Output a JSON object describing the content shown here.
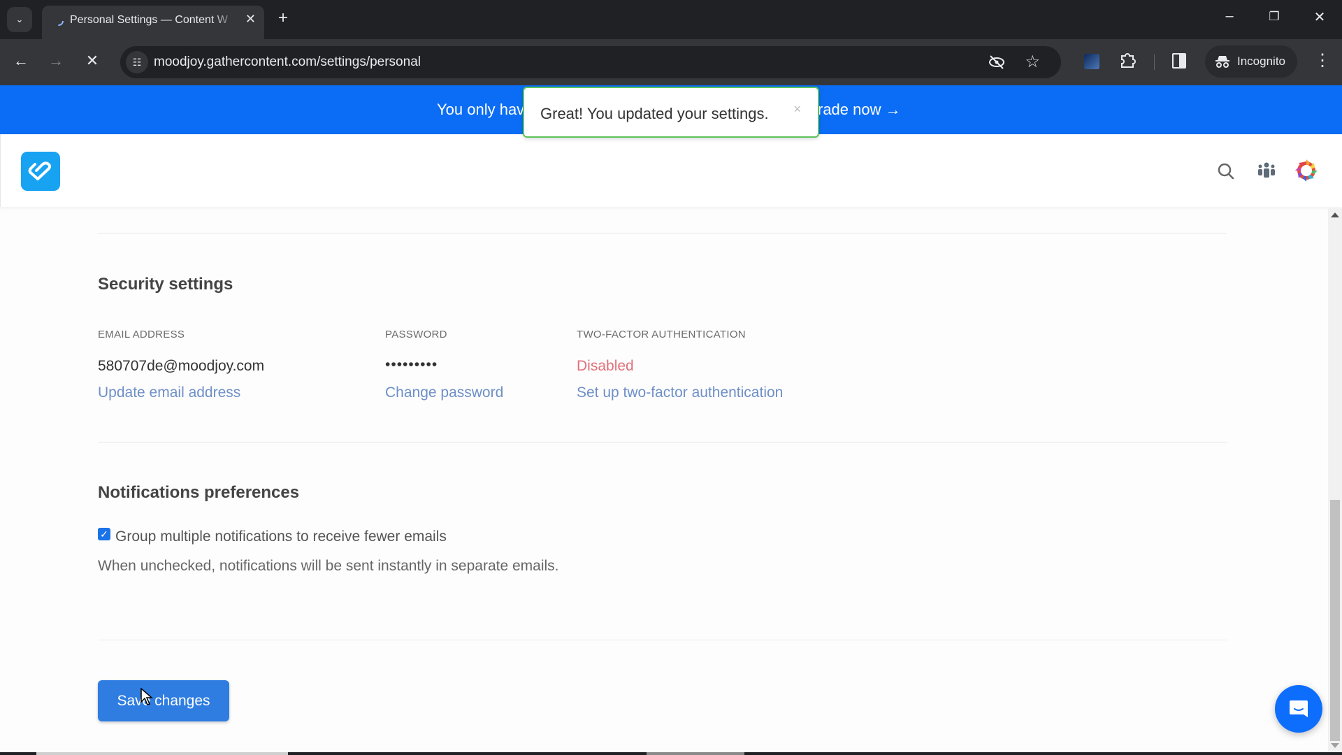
{
  "browser": {
    "tab_title": "Personal Settings — Content W",
    "url": "moodjoy.gathercontent.com/settings/personal",
    "profile_label": "Incognito",
    "icons": {
      "tab_list": "chevron-down-icon",
      "tab_close": "close-icon",
      "new_tab": "plus-icon",
      "back": "arrow-left-icon",
      "forward": "arrow-right-icon",
      "stop": "close-icon",
      "site_info": "tune-icon",
      "tracking": "eye-off-icon",
      "bookmark": "star-icon",
      "extensions": "puzzle-icon",
      "side_panel": "side-panel-icon",
      "incognito": "incognito-icon",
      "menu": "more-vert-icon"
    },
    "window_controls": {
      "minimize": "–",
      "restore": "❐",
      "close": "✕"
    }
  },
  "banner": {
    "text_left": "You only hav",
    "text_right": "rade now →",
    "color": "#0b6df5"
  },
  "toast": {
    "message": "Great! You updated your settings.",
    "close_label": "×",
    "border_color": "#5cc25a"
  },
  "header": {
    "logo": "gathercontent-logo",
    "icons": [
      "search-icon",
      "team-icon",
      "workspace-avatar"
    ]
  },
  "security": {
    "title": "Security settings",
    "email": {
      "label": "EMAIL ADDRESS",
      "value": "580707de@moodjoy.com",
      "link": "Update email address"
    },
    "password": {
      "label": "PASSWORD",
      "value": "•••••••••",
      "link": "Change password"
    },
    "two_factor": {
      "label": "TWO-FACTOR AUTHENTICATION",
      "status": "Disabled",
      "status_color": "#e0707a",
      "link": "Set up two-factor authentication"
    }
  },
  "notifications": {
    "title": "Notifications preferences",
    "group_checkbox": {
      "checked": true,
      "label": "Group multiple notifications to receive fewer emails"
    },
    "help_text": "When unchecked, notifications will be sent instantly in separate emails."
  },
  "actions": {
    "save_label": "Save changes",
    "save_color": "#2f7de1"
  },
  "scroll": {
    "position_fraction": 1.0
  },
  "chat_widget": "chat-bubble-icon"
}
